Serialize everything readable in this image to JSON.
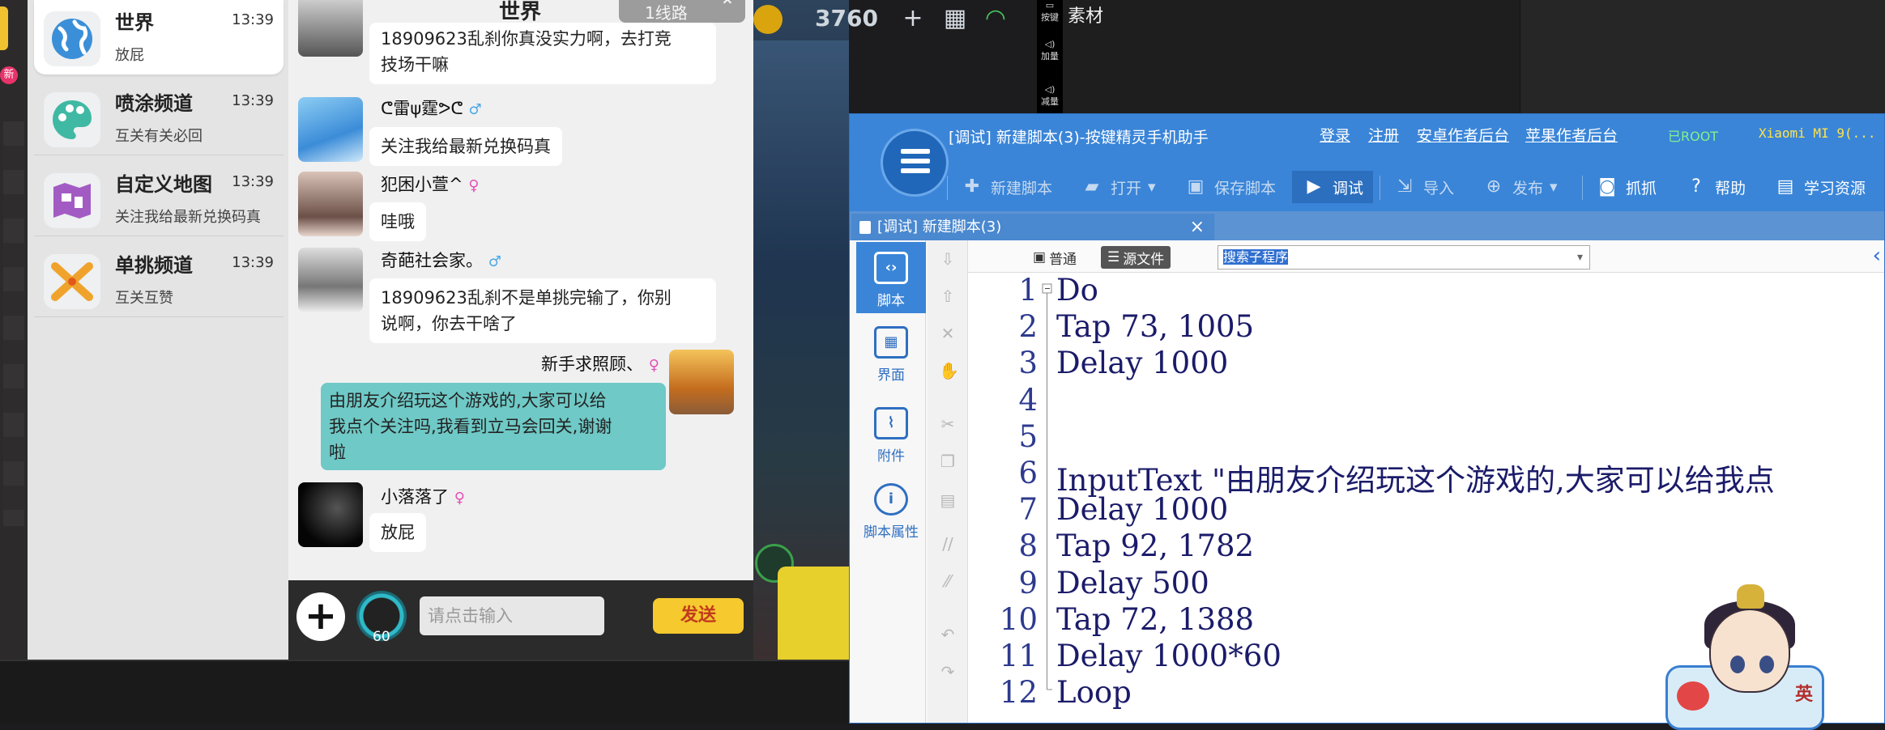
{
  "left_strip": {
    "new_badge": "新"
  },
  "channels": [
    {
      "name": "世界",
      "time": "13:39",
      "last": "放屁",
      "icon": "globe-icon",
      "color": "#3b8fd8"
    },
    {
      "name": "喷涂频道",
      "time": "13:39",
      "last": "互关有关必回",
      "icon": "palette-icon",
      "color": "#3fb9a4"
    },
    {
      "name": "自定义地图",
      "time": "13:39",
      "last": "关注我给最新兑换码真",
      "icon": "map-icon",
      "color": "#a35bc4"
    },
    {
      "name": "单挑频道",
      "time": "13:39",
      "last": "互关互赞",
      "icon": "swords-icon",
      "color": "#f0a32c"
    }
  ],
  "chat": {
    "title": "世界",
    "line_selector": "1线路",
    "messages": [
      {
        "user": "",
        "text": "18909623乱刹你真没实力啊，去打竞技场干嘛",
        "line1": "18909623乱刹你真没实力啊，去打竞",
        "line2": "技场干嘛"
      },
      {
        "user": "ᕦ雷ψ霆ᕗᕦ",
        "gender": "♂",
        "text": "关注我给最新兑换码真"
      },
      {
        "user": "犯困小萱^",
        "gender": "♀",
        "text": "哇哦"
      },
      {
        "user": "奇葩社会家。",
        "gender": "♂",
        "text": "18909623乱刹不是单挑完输了，你别说啊，你去干啥了",
        "line1": "18909623乱刹不是单挑完输了，你别",
        "line2": "说啊，你去干啥了"
      },
      {
        "user": "新手求照顾、",
        "gender": "♀",
        "mine": true,
        "line1": "由朋友介绍玩这个游戏的,大家可以给",
        "line2": "我点个关注吗,我看到立马会回关,谢谢",
        "line3": "啦"
      },
      {
        "user": "小落落了",
        "gender": "♀",
        "text": "放屁"
      }
    ],
    "input_placeholder": "请点击输入",
    "voice_count": "60",
    "send_label": "发送"
  },
  "game_hud": {
    "coins": "3760",
    "side_buttons": [
      "按键",
      "加量",
      "减量"
    ]
  },
  "desktop": {
    "material_text": "素材"
  },
  "ide": {
    "title": "[调试] 新建脚本(3)-按键精灵手机助手",
    "links": [
      "登录",
      "注册",
      "安卓作者后台",
      "苹果作者后台"
    ],
    "root_tag": "已ROOT",
    "device_tag": "Xiaomi  MI 9(...",
    "toolbar": [
      {
        "label": "新建脚本",
        "icon": "plus-icon"
      },
      {
        "label": "打开",
        "icon": "folder-icon"
      },
      {
        "label": "保存脚本",
        "icon": "save-icon"
      },
      {
        "label": "调试",
        "icon": "play-icon"
      },
      {
        "label": "导入",
        "icon": "import-icon"
      },
      {
        "label": "发布",
        "icon": "publish-icon"
      },
      {
        "label": "抓抓",
        "icon": "camera-icon"
      },
      {
        "label": "帮助",
        "icon": "help-icon"
      },
      {
        "label": "学习资源",
        "icon": "book-icon"
      }
    ],
    "doc_tab": "[调试] 新建脚本(3)",
    "sidebar": [
      {
        "label": "脚本",
        "icon": "script-icon"
      },
      {
        "label": "界面",
        "icon": "layout-icon"
      },
      {
        "label": "附件",
        "icon": "attachment-icon"
      },
      {
        "label": "脚本属性",
        "icon": "info-icon"
      }
    ],
    "modes": [
      "普通",
      "源文件"
    ],
    "search_text": "搜索子程序",
    "code_lines": [
      {
        "n": "1",
        "code": "Do"
      },
      {
        "n": "2",
        "code": "Tap 73, 1005"
      },
      {
        "n": "3",
        "code": "Delay 1000"
      },
      {
        "n": "4",
        "code": ""
      },
      {
        "n": "5",
        "code": ""
      },
      {
        "n": "6",
        "code": "InputText \"由朋友介绍玩这个游戏的,大家可以给我点"
      },
      {
        "n": "7",
        "code": "Delay 1000"
      },
      {
        "n": "8",
        "code": "Tap 92, 1782"
      },
      {
        "n": "9",
        "code": "Delay 500"
      },
      {
        "n": "10",
        "code": "Tap 72, 1388"
      },
      {
        "n": "11",
        "code": "Delay 1000*60"
      },
      {
        "n": "12",
        "code": "Loop"
      }
    ],
    "mascot_seal": "英"
  }
}
